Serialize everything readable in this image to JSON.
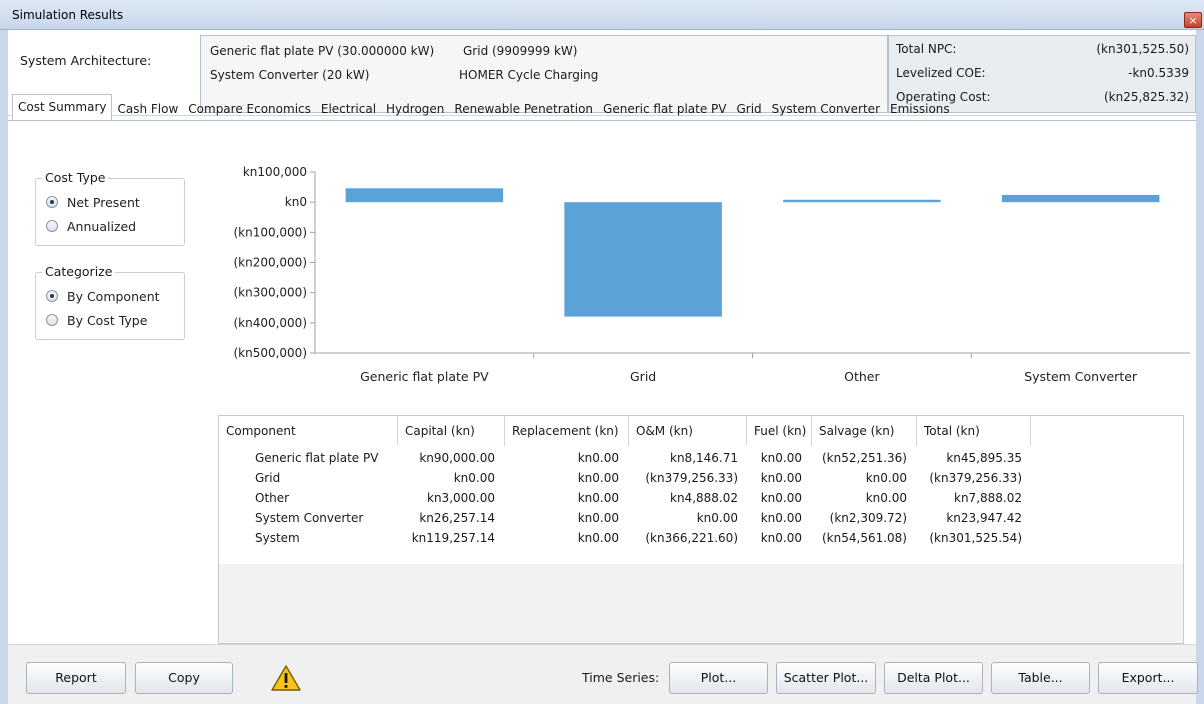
{
  "window": {
    "title": "Simulation Results",
    "close_glyph": "×"
  },
  "architecture": {
    "label": "System Architecture:",
    "items": [
      "Generic flat plate PV (30.000000 kW)",
      "Grid (9909999 kW)",
      "System Converter (20 kW)",
      "HOMER Cycle Charging"
    ]
  },
  "metrics": [
    {
      "label": "Total NPC:",
      "value": "(kn301,525.50)"
    },
    {
      "label": "Levelized COE:",
      "value": "-kn0.5339"
    },
    {
      "label": "Operating Cost:",
      "value": "(kn25,825.32)"
    }
  ],
  "tabs": [
    "Cost Summary",
    "Cash Flow",
    "Compare Economics",
    "Electrical",
    "Hydrogen",
    "Renewable Penetration",
    "Generic flat plate PV",
    "Grid",
    "System Converter",
    "Emissions"
  ],
  "active_tab": 0,
  "cost_type": {
    "title": "Cost Type",
    "options": [
      "Net Present",
      "Annualized"
    ],
    "selected": 0
  },
  "categorize": {
    "title": "Categorize",
    "options": [
      "By Component",
      "By Cost Type"
    ],
    "selected": 0
  },
  "chart_data": {
    "type": "bar",
    "categories": [
      "Generic flat plate PV",
      "Grid",
      "Other",
      "System Converter"
    ],
    "values": [
      45895.35,
      -379256.33,
      7888.02,
      23947.42
    ],
    "ylim": [
      -500000,
      100000
    ],
    "yticks": [
      100000,
      0,
      -100000,
      -200000,
      -300000,
      -400000,
      -500000
    ],
    "ytick_labels": [
      "kn100,000",
      "kn0",
      "(kn100,000)",
      "(kn200,000)",
      "(kn300,000)",
      "(kn400,000)",
      "(kn500,000)"
    ],
    "bar_color": "#5ba3d6",
    "grid": false
  },
  "table": {
    "columns": [
      "Component",
      "Capital (kn)",
      "Replacement (kn)",
      "O&M (kn)",
      "Fuel (kn)",
      "Salvage (kn)",
      "Total (kn)"
    ],
    "rows": [
      [
        "Generic flat plate PV",
        "kn90,000.00",
        "kn0.00",
        "kn8,146.71",
        "kn0.00",
        "(kn52,251.36)",
        "kn45,895.35"
      ],
      [
        "Grid",
        "kn0.00",
        "kn0.00",
        "(kn379,256.33)",
        "kn0.00",
        "kn0.00",
        "(kn379,256.33)"
      ],
      [
        "Other",
        "kn3,000.00",
        "kn0.00",
        "kn4,888.02",
        "kn0.00",
        "kn0.00",
        "kn7,888.02"
      ],
      [
        "System Converter",
        "kn26,257.14",
        "kn0.00",
        "kn0.00",
        "kn0.00",
        "(kn2,309.72)",
        "kn23,947.42"
      ],
      [
        "System",
        "kn119,257.14",
        "kn0.00",
        "(kn366,221.60)",
        "kn0.00",
        "(kn54,561.08)",
        "(kn301,525.54)"
      ]
    ]
  },
  "bottom": {
    "report": "Report",
    "copy": "Copy",
    "warning_icon": "warning-triangle-icon",
    "time_series_label": "Time Series:",
    "plot": "Plot...",
    "scatter_plot": "Scatter Plot...",
    "delta_plot": "Delta Plot...",
    "table": "Table...",
    "export": "Export..."
  }
}
